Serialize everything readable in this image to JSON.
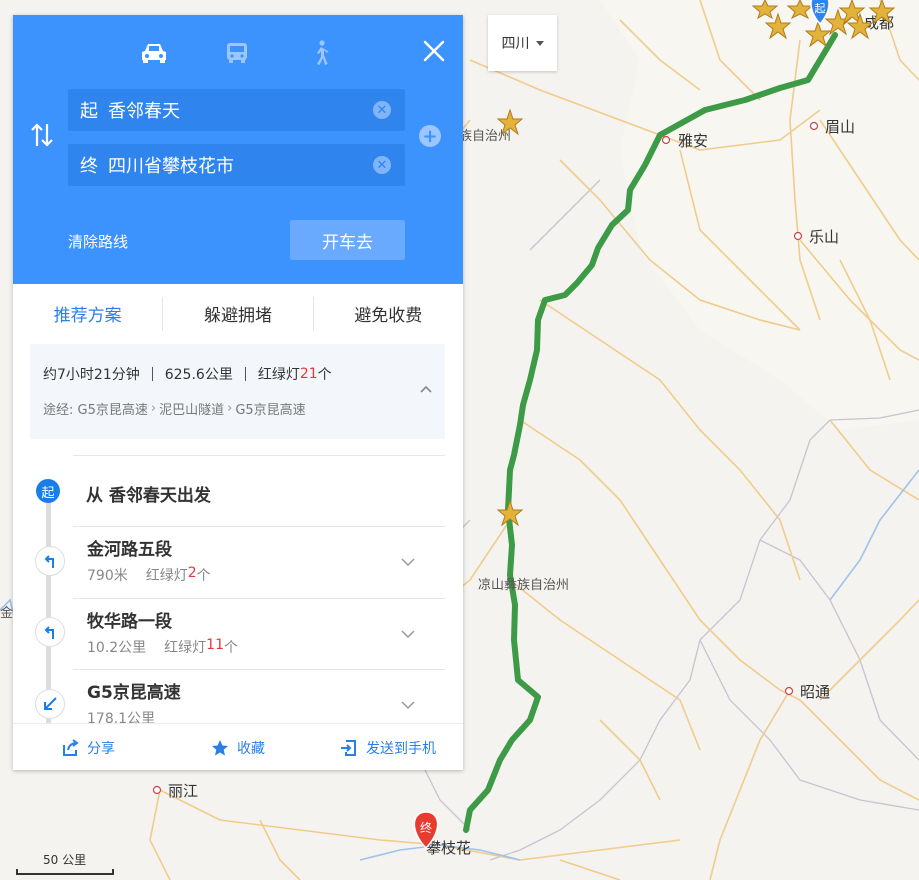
{
  "map": {
    "cities": {
      "chengdu": "成都",
      "yaan": "雅安",
      "meishan": "眉山",
      "leshan": "乐山",
      "zhaotong": "昭通",
      "lijiang": "丽江",
      "panzhihua": "攀枝花"
    },
    "regions": {
      "liangshan": "凉山彝族自治州",
      "ganzi_partial": "族自治州",
      "jinsha_partial": "金沙"
    },
    "route_color": "#3d9a46",
    "start_marker": "起",
    "end_marker": "终"
  },
  "region_select": {
    "value": "四川"
  },
  "panel": {
    "modes": {
      "drive_icon": "car-icon",
      "bus_icon": "bus-icon",
      "walk_icon": "walk-icon"
    },
    "start": {
      "tag": "起",
      "value": "香邻春天"
    },
    "end": {
      "tag": "终",
      "value": "四川省攀枝花市"
    },
    "clear_route": "清除路线",
    "go_button": "开车去",
    "tabs": [
      "推荐方案",
      "躲避拥堵",
      "避免收费"
    ],
    "summary": {
      "time": "约7小时21分钟",
      "distance": "625.6公里",
      "lights_prefix": "红绿灯",
      "lights_count": "21",
      "lights_suffix": "个",
      "via_label": "途经:",
      "via": [
        "G5京昆高速",
        "泥巴山隧道",
        "G5京昆高速"
      ]
    },
    "steps_start": {
      "badge": "起",
      "text": "从 香邻春天出发"
    },
    "steps": [
      {
        "name": "金河路五段",
        "distance": "790米",
        "lights_prefix": "红绿灯",
        "lights": "2",
        "lights_suffix": "个"
      },
      {
        "name": "牧华路一段",
        "distance": "10.2公里",
        "lights_prefix": "红绿灯",
        "lights": "11",
        "lights_suffix": "个"
      },
      {
        "name": "G5京昆高速",
        "distance": "178.1公里",
        "lights_prefix": "",
        "lights": "",
        "lights_suffix": ""
      }
    ],
    "footer": {
      "share": "分享",
      "favorite": "收藏",
      "send": "发送到手机"
    }
  },
  "scale": {
    "label": "50 公里"
  },
  "colors": {
    "accent": "#3d93fd",
    "route": "#3d9a46",
    "highlight_red": "#e4393c"
  }
}
